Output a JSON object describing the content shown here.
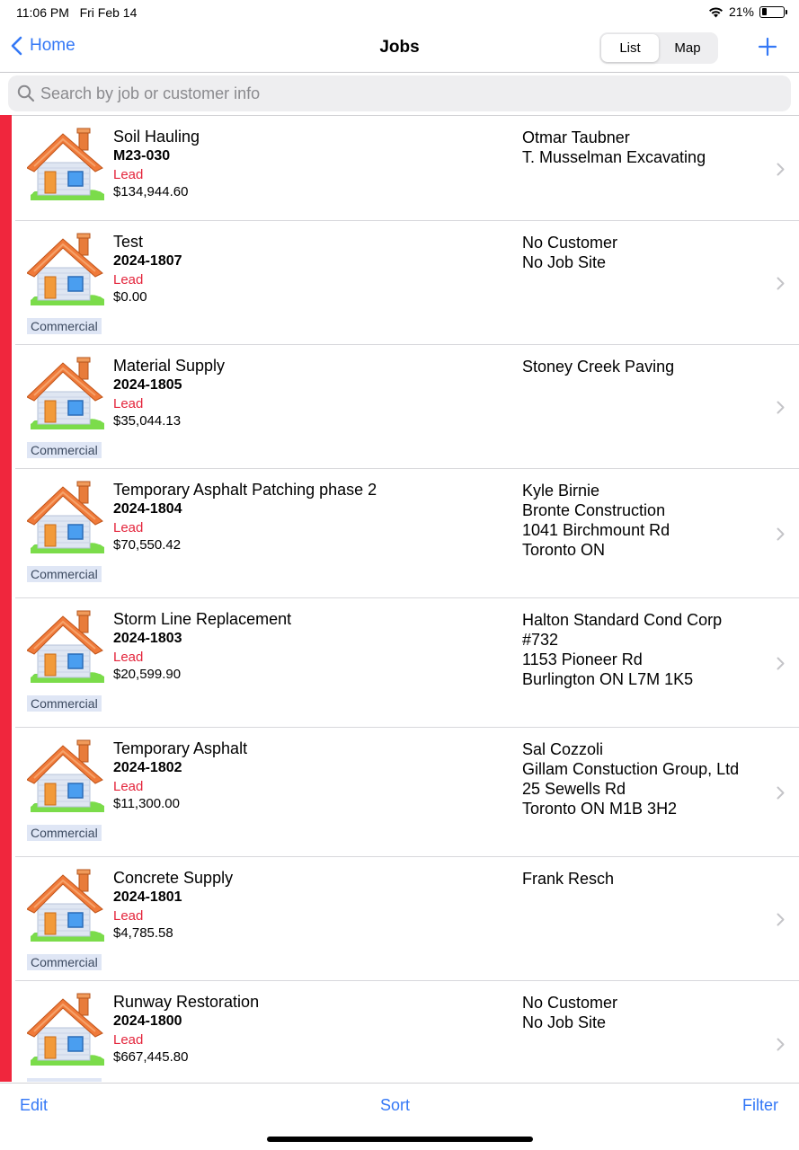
{
  "status_bar": {
    "time": "11:06 PM",
    "date": "Fri Feb 14",
    "battery": "21%",
    "battery_level": 0.21,
    "wifi_icon": "wifi-icon",
    "battery_icon": "battery-icon"
  },
  "nav": {
    "back_label": "Home",
    "title": "Jobs",
    "seg_list": "List",
    "seg_map": "Map",
    "selected_segment": "List",
    "add_icon": "plus-icon"
  },
  "search": {
    "placeholder": "Search by job or customer info",
    "value": ""
  },
  "colors": {
    "accent": "#3478f6",
    "lead": "#e4253c",
    "lead_bar": "#f0263d",
    "badge_bg": "#dfe6f5"
  },
  "jobs": [
    {
      "name": "Soil Hauling",
      "number": "M23-030",
      "status": "Lead",
      "amount": "$134,944.60",
      "badge": "",
      "customer": [
        "Otmar Taubner",
        "T. Musselman Excavating"
      ]
    },
    {
      "name": "Test",
      "number": "2024-1807",
      "status": "Lead",
      "amount": "$0.00",
      "badge": "Commercial",
      "customer": [
        "No Customer",
        "No Job Site"
      ]
    },
    {
      "name": "Material Supply",
      "number": "2024-1805",
      "status": "Lead",
      "amount": "$35,044.13",
      "badge": "Commercial",
      "customer": [
        "Stoney Creek Paving"
      ]
    },
    {
      "name": "Temporary Asphalt Patching phase 2",
      "number": "2024-1804",
      "status": "Lead",
      "amount": "$70,550.42",
      "badge": "Commercial",
      "customer": [
        "Kyle  Birnie",
        "Bronte Construction",
        "1041 Birchmount Rd",
        "Toronto ON"
      ]
    },
    {
      "name": "Storm Line Replacement",
      "number": "2024-1803",
      "status": "Lead",
      "amount": "$20,599.90",
      "badge": "Commercial",
      "customer": [
        "Halton Standard Cond Corp",
        "#732",
        "1153 Pioneer Rd",
        "Burlington ON L7M 1K5"
      ]
    },
    {
      "name": "Temporary Asphalt",
      "number": "2024-1802",
      "status": "Lead",
      "amount": "$11,300.00",
      "badge": "Commercial",
      "customer": [
        "Sal Cozzoli",
        "Gillam Constuction Group, Ltd",
        "25 Sewells Rd",
        "Toronto ON M1B 3H2"
      ]
    },
    {
      "name": "Concrete Supply",
      "number": "2024-1801",
      "status": "Lead",
      "amount": "$4,785.58",
      "badge": "Commercial",
      "customer": [
        "Frank Resch"
      ]
    },
    {
      "name": "Runway Restoration",
      "number": "2024-1800",
      "status": "Lead",
      "amount": "$667,445.80",
      "badge": "Commercial",
      "customer": [
        "No Customer",
        "No Job Site"
      ]
    }
  ],
  "toolbar": {
    "edit": "Edit",
    "sort": "Sort",
    "filter": "Filter"
  }
}
